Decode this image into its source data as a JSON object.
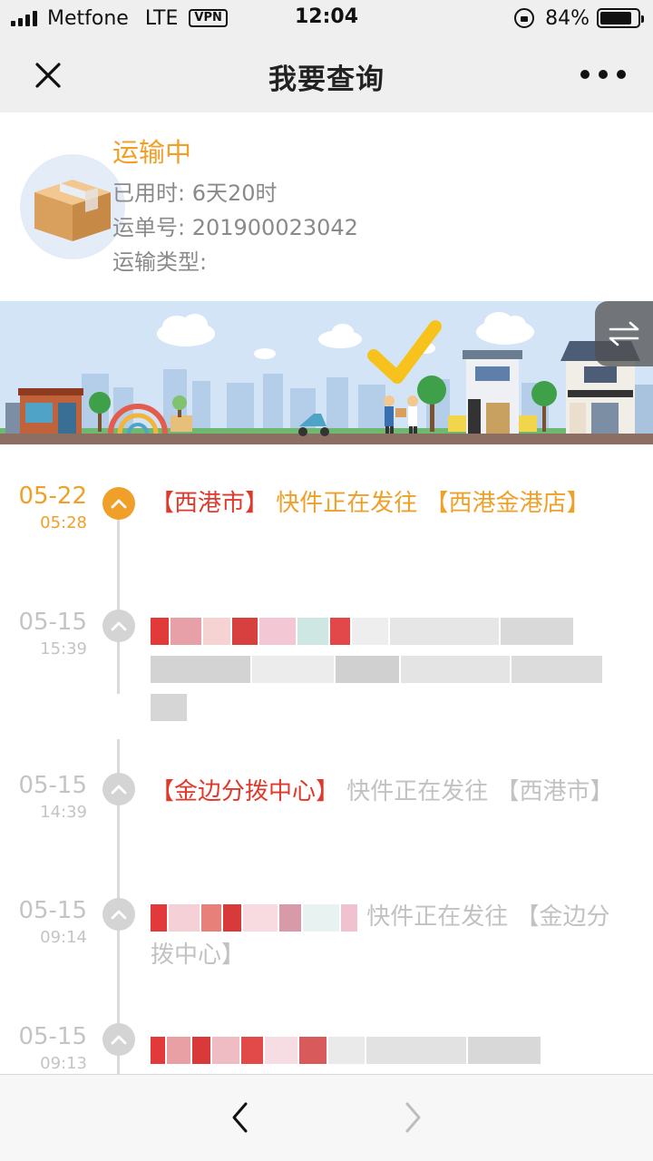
{
  "status_bar": {
    "carrier": "Metfone",
    "network": "LTE",
    "vpn": "VPN",
    "time": "12:04",
    "battery_percent": "84%",
    "battery_level": 0.84
  },
  "nav": {
    "title": "我要查询",
    "close_icon": "close-icon",
    "more_icon": "more-dots-icon"
  },
  "summary": {
    "status": "运输中",
    "elapsed": "已用时: 6天20时",
    "tracking_no": "运单号: 201900023042",
    "transport_type": "运输类型:"
  },
  "colors": {
    "accent_orange": "#f0a028",
    "highlight_red": "#e2382b",
    "muted_gray": "#c2c2c2"
  },
  "timeline": [
    {
      "date": "05-22",
      "time": "05:28",
      "current": true,
      "prefix": "【西港市】",
      "rest": " 快件正在发往 【西港金港店】"
    },
    {
      "date": "05-15",
      "time": "15:39",
      "current": false,
      "prefix": "",
      "rest": ""
    },
    {
      "date": "05-15",
      "time": "14:39",
      "current": false,
      "prefix": "【金边分拨中心】",
      "rest": " 快件正在发往 【西港市】"
    },
    {
      "date": "05-15",
      "time": "09:14",
      "current": false,
      "prefix": "",
      "rest": " 快件正在发往 【金边分拨中心】"
    },
    {
      "date": "05-15",
      "time": "09:13",
      "current": false,
      "prefix": "",
      "rest": ""
    }
  ],
  "toolbar": {
    "back_icon": "chevron-left-icon",
    "forward_icon": "chevron-right-icon"
  }
}
